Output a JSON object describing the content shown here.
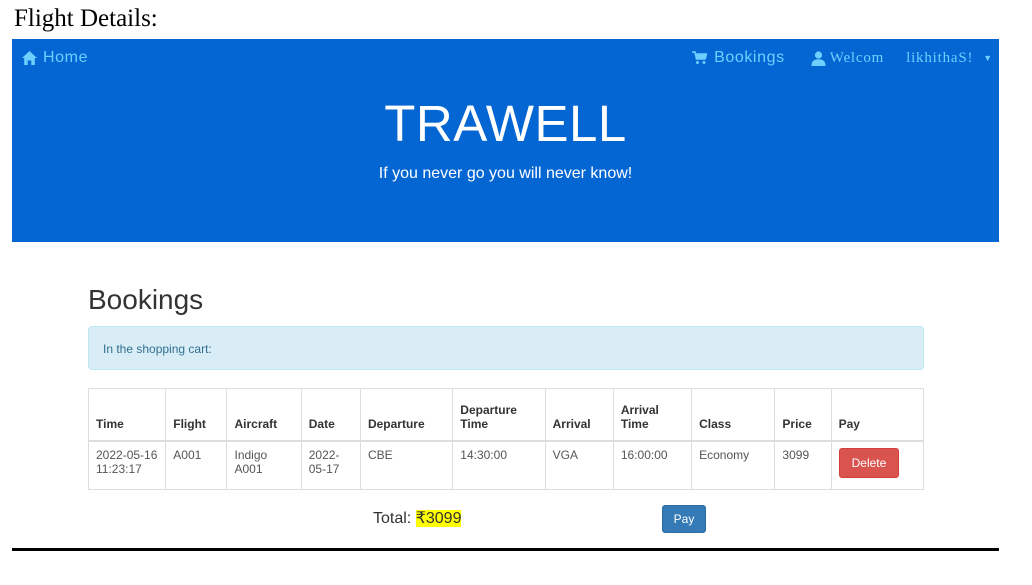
{
  "page": {
    "heading": "Flight Details:"
  },
  "navbar": {
    "home_label": "Home",
    "bookings_label": "Bookings",
    "welcome_label": "Welcom",
    "username": "likhithaS!",
    "brand": "TRAWELL",
    "tagline": "If you never go you will never know!",
    "colors": {
      "background": "#0466d3",
      "link": "#6fd0ff"
    },
    "icons": {
      "home": "home-icon",
      "cart": "cart-icon",
      "user": "user-icon",
      "caret": "caret-down-icon"
    }
  },
  "bookings": {
    "title": "Bookings",
    "alert_text": "In the shopping cart:",
    "columns": [
      "Time",
      "Flight",
      "Aircraft",
      "Date",
      "Departure",
      "Departure Time",
      "Arrival",
      "Arrival Time",
      "Class",
      "Price",
      "Pay"
    ],
    "rows": [
      {
        "time": "2022-05-16 11:23:17",
        "flight": "A001",
        "aircraft": "Indigo A001",
        "date": "2022-05-17",
        "departure": "CBE",
        "departure_time": "14:30:00",
        "arrival": "VGA",
        "arrival_time": "16:00:00",
        "class": "Economy",
        "price": "3099",
        "action_label": "Delete"
      }
    ],
    "total_label": "Total:",
    "total_amount": "₹3099",
    "pay_label": "Pay",
    "colors": {
      "delete": "#d9534f",
      "pay": "#337ab7",
      "highlight": "#ffff00",
      "alert_bg": "#d9edf7"
    }
  }
}
